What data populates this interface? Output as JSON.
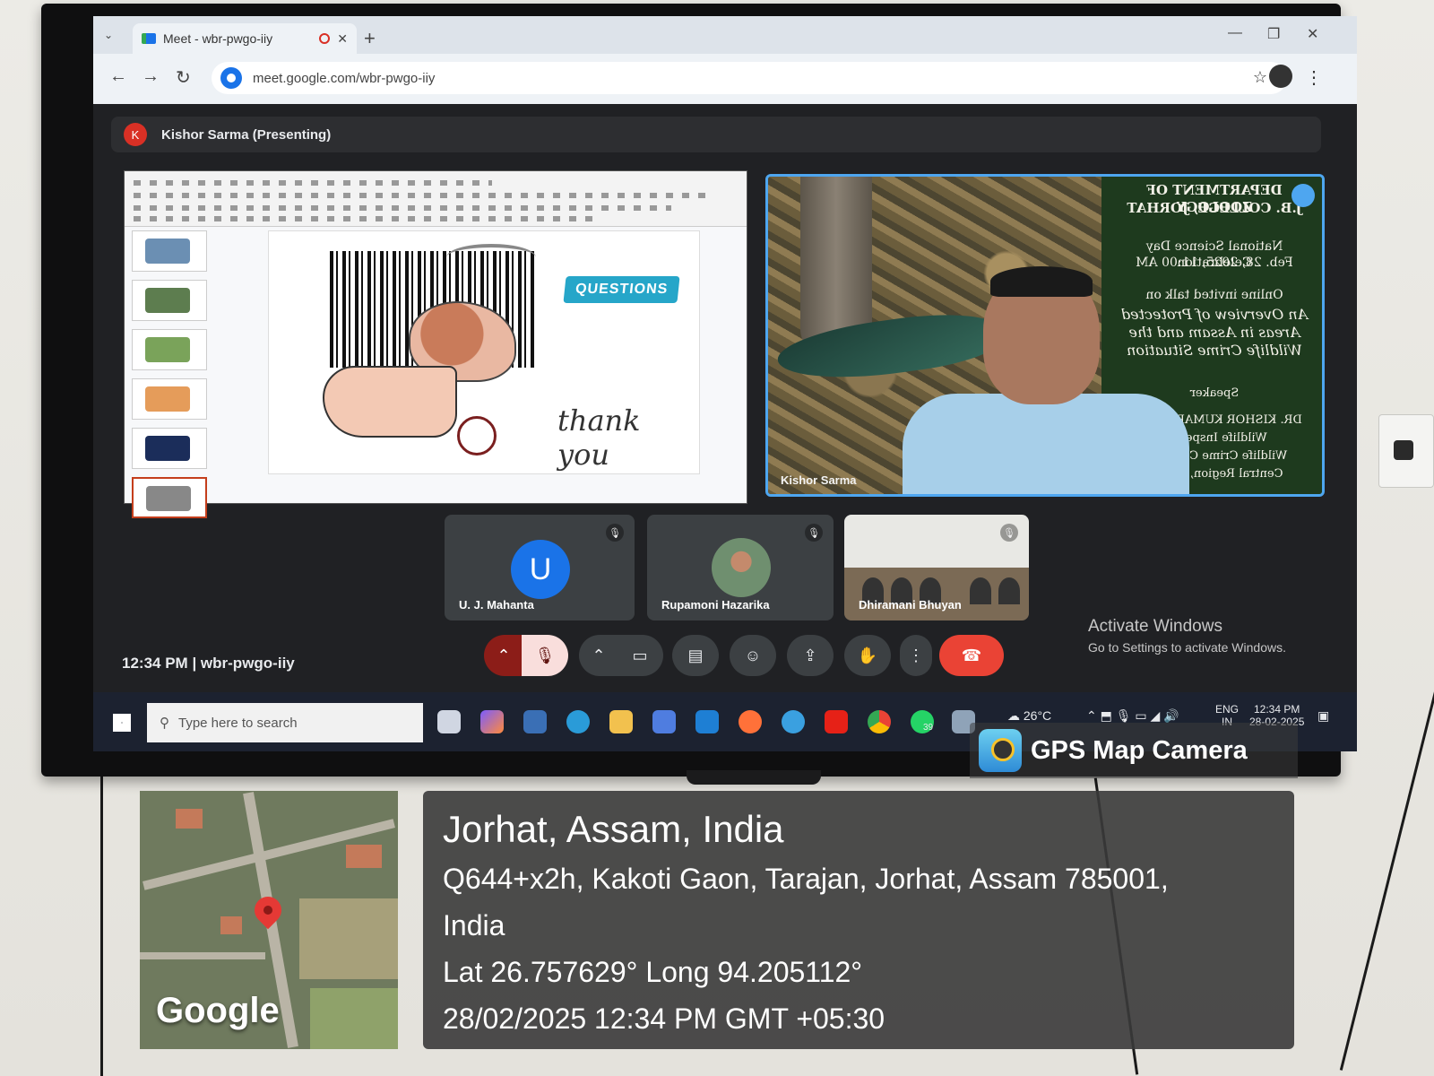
{
  "browser": {
    "tab_title": "Meet - wbr-pwgo-iiy",
    "new_tab": "+",
    "url": "meet.google.com/wbr-pwgo-iiy"
  },
  "meet": {
    "presenter_initial": "K",
    "presenter_label": "Kishor Sarma (Presenting)",
    "slide": {
      "badge": "QUESTIONS",
      "thanks": "thank you"
    },
    "camera": {
      "name": "Kishor Sarma",
      "banner_lines": [
        "DEPARTMENT OF ZOOLOGY",
        "J.B. COLLEGE, JORHAT",
        "National Science Day Celebration",
        "Feb. 28, 2025, 11:00 AM",
        "Online invited talk on",
        "An Overview of Protected",
        "Areas in Assam and the",
        "Wildlife Crime Situation",
        "Speaker",
        "DR. KISHOR KUMAR SARMA",
        "Wildlife Inspector",
        "Wildlife Crime Control B",
        "Central Region, Madhy"
      ]
    },
    "participants": [
      {
        "name": "U. J. Mahanta",
        "initial": "U"
      },
      {
        "name": "Rupamoni Hazarika"
      },
      {
        "name": "Dhiramani Bhuyan"
      }
    ],
    "footer_time": "12:34 PM",
    "meeting_code": "wbr-pwgo-iiy",
    "activate_title": "Activate Windows",
    "activate_sub": "Go to Settings to activate Windows."
  },
  "taskbar": {
    "search_placeholder": "Type here to search",
    "weather": "26°C",
    "lang": "ENG",
    "region": "IN",
    "time": "12:34 PM",
    "date": "28-02-2025",
    "whatsapp_badge": "39"
  },
  "gps": {
    "app_name": "GPS Map Camera",
    "map_brand": "Google",
    "city": "Jorhat, Assam, India",
    "address_line1": "Q644+x2h, Kakoti Gaon, Tarajan, Jorhat, Assam 785001,",
    "address_line2": "India",
    "coords": "Lat 26.757629° Long 94.205112°",
    "datetime": "28/02/2025 12:34 PM GMT +05:30"
  }
}
